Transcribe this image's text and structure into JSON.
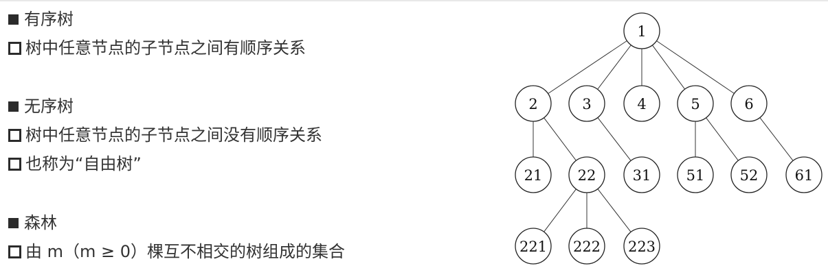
{
  "sections": [
    {
      "heading": "有序树",
      "items": [
        "树中任意节点的子节点之间有顺序关系"
      ]
    },
    {
      "heading": "无序树",
      "items": [
        "树中任意节点的子节点之间没有顺序关系",
        "也称为“自由树”"
      ]
    },
    {
      "heading": "森林",
      "items": [
        "由 m（m ≥ 0）棵互不相交的树组成的集合"
      ]
    }
  ],
  "tree": {
    "nodes": [
      "1",
      "2",
      "3",
      "4",
      "5",
      "6",
      "21",
      "22",
      "31",
      "51",
      "52",
      "61",
      "221",
      "222",
      "223"
    ],
    "edges": [
      [
        "1",
        "2"
      ],
      [
        "1",
        "3"
      ],
      [
        "1",
        "4"
      ],
      [
        "1",
        "5"
      ],
      [
        "1",
        "6"
      ],
      [
        "2",
        "21"
      ],
      [
        "2",
        "22"
      ],
      [
        "3",
        "31"
      ],
      [
        "5",
        "51"
      ],
      [
        "5",
        "52"
      ],
      [
        "6",
        "61"
      ],
      [
        "22",
        "221"
      ],
      [
        "22",
        "222"
      ],
      [
        "22",
        "223"
      ]
    ]
  }
}
